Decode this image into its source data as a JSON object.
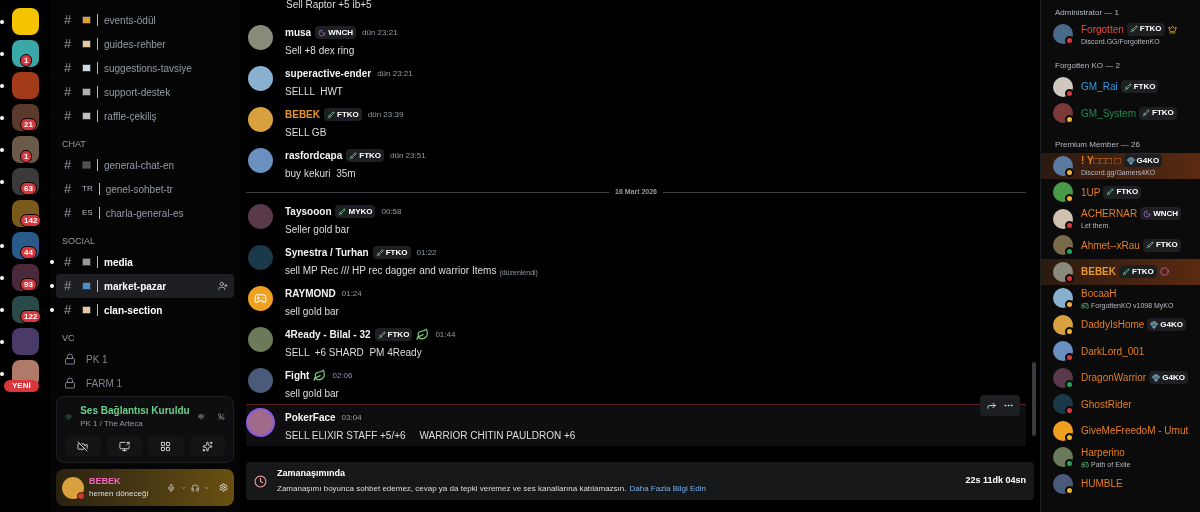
{
  "servers": [
    {
      "unread": true
    },
    {
      "unread": true,
      "badge": "1"
    },
    {
      "unread": true
    },
    {
      "unread": true,
      "badge": "21"
    },
    {
      "unread": true,
      "badge": "1"
    },
    {
      "unread": true,
      "badge": "63"
    },
    {
      "unread": false,
      "badge": "142"
    },
    {
      "unread": true,
      "badge": "44"
    },
    {
      "unread": true,
      "badge": "93"
    },
    {
      "unread": true,
      "badge": "122"
    },
    {
      "unread": true
    },
    {
      "unread": true,
      "new_label": "YENİ"
    }
  ],
  "channels": [
    {
      "kind": "text",
      "hash": "#",
      "name": "events-ödül",
      "unread": false,
      "selected": false
    },
    {
      "kind": "text",
      "hash": "#",
      "name": "guides-rehber",
      "unread": false,
      "selected": false
    },
    {
      "kind": "text",
      "hash": "#",
      "name": "suggestions-tavsiye",
      "unread": false,
      "selected": false
    },
    {
      "kind": "text",
      "hash": "#",
      "name": "support-destek",
      "unread": false,
      "selected": false
    },
    {
      "kind": "text",
      "hash": "#",
      "name": "raffle-çekiliş",
      "unread": false,
      "selected": false
    },
    {
      "kind": "category",
      "name": "CHAT"
    },
    {
      "kind": "text",
      "hash": "#",
      "name": "general-chat-en",
      "unread": false,
      "selected": false
    },
    {
      "kind": "text",
      "hash": "#",
      "prefix": "TR",
      "name": "genel-sohbet-tr",
      "unread": false,
      "selected": false
    },
    {
      "kind": "text",
      "hash": "#",
      "prefix": "ES",
      "name": "charla-general-es",
      "unread": false,
      "selected": false
    },
    {
      "kind": "category",
      "name": "SOCIAL"
    },
    {
      "kind": "text",
      "hash": "#",
      "name": "media",
      "unread": true,
      "selected": false
    },
    {
      "kind": "text",
      "hash": "#",
      "name": "market-pazar",
      "unread": true,
      "selected": true
    },
    {
      "kind": "text",
      "hash": "#",
      "name": "clan-section",
      "unread": true,
      "selected": false
    },
    {
      "kind": "category",
      "name": "VC"
    },
    {
      "kind": "voice",
      "name": "PK 1"
    },
    {
      "kind": "voice",
      "name": "FARM 1"
    }
  ],
  "voice_panel": {
    "status": "Ses Bağlantısı Kuruldu",
    "channel": "PK 1 / The Arteca"
  },
  "user_panel": {
    "name": "BEBEK",
    "status_text": "hemen döneceği"
  },
  "messages": [
    {
      "continued": true,
      "text": "Sell Raptor +5 ib+5"
    },
    {
      "author": "musa",
      "color": "#f2f3f5",
      "tags": [
        {
          "kind": "moon",
          "label": "WNCH"
        }
      ],
      "time": "dün 23:21",
      "text": "Sell +8 dex ring"
    },
    {
      "author": "superactive-ender",
      "color": "#f2f3f5",
      "time": "dün 23:21",
      "text": "SELLL  HWT"
    },
    {
      "author": "BEBEK",
      "color": "#e8962a",
      "tags": [
        {
          "kind": "sword",
          "label": "FTKO"
        }
      ],
      "time": "dün 23:39",
      "text": "SELL GB"
    },
    {
      "author": "rasfordcapa",
      "color": "#f2f3f5",
      "tags": [
        {
          "kind": "sword",
          "label": "FTKO"
        }
      ],
      "time": "dün 23:51",
      "text": "buy kekuri  35m"
    },
    {
      "divider": "16 Mart 2026"
    },
    {
      "author": "Taysooon",
      "color": "#f2f3f5",
      "tags": [
        {
          "kind": "sword",
          "label": "MYKO"
        }
      ],
      "time": "00:58",
      "text": "Seller gold bar"
    },
    {
      "author": "Synestra / Turhan",
      "color": "#f2f3f5",
      "tags": [
        {
          "kind": "sword",
          "label": "FTKO"
        }
      ],
      "time": "01:22",
      "text": "sell MP Rec /// HP rec dagger and warrior Items",
      "edited": "(düzenlendi)"
    },
    {
      "author": "RAYMOND",
      "color": "#f2f3f5",
      "time": "01:24",
      "text": "sell gold bar",
      "default_avatar": true
    },
    {
      "author": "4Ready - Bilal - 32",
      "color": "#f2f3f5",
      "tags": [
        {
          "kind": "sword",
          "label": "FTKO"
        },
        {
          "kind": "leaf"
        }
      ],
      "time": "01:44",
      "text": "SELL  +6 SHARD  PM 4Ready"
    },
    {
      "author": "Fight",
      "color": "#f2f3f5",
      "tags": [
        {
          "kind": "leaf"
        }
      ],
      "time": "02:06",
      "text": "sell gold bar"
    },
    {
      "new_marker": true
    },
    {
      "author": "PokerFace",
      "color": "#f2f3f5",
      "time": "03:04",
      "text": "SELL ELIXIR STAFF +5/+6     WARRIOR CHITIN PAULDRON +6",
      "hovered": true
    }
  ],
  "timeout": {
    "title": "Zamanaşımında",
    "text": "Zamanaşımı boyunca sohbet edemez, cevap ya da tepki veremez ve ses kanallarına katılamazsın.",
    "link": "Daha Fazla Bilgi Edin",
    "remaining": "22s 11dk 04sn"
  },
  "member_groups": [
    {
      "title": "Administrator — 1",
      "members": [
        {
          "name": "Forgotten",
          "color": "#e74c3c",
          "tags": [
            {
              "kind": "sword",
              "label": "FTKO"
            }
          ],
          "crown": true,
          "kind": "dnd",
          "sub": "Discord.GG/ForgottenKO"
        }
      ]
    },
    {
      "title": "Forgotten KO — 2",
      "members": [
        {
          "name": "GM_Rai",
          "color": "#3498db",
          "tags": [
            {
              "kind": "sword",
              "label": "FTKO"
            }
          ],
          "kind": "dnd"
        },
        {
          "name": "GM_System",
          "color": "#1f8b4c",
          "tags": [
            {
              "kind": "sword",
              "label": "FTKO"
            }
          ],
          "kind": "idle"
        }
      ]
    },
    {
      "title": "Premium Member — 26",
      "members": [
        {
          "name": "! Y□□□ □",
          "color": "#e67e22",
          "tags": [
            {
              "kind": "gem",
              "label": "G4KO"
            }
          ],
          "kind": "idle",
          "sub": "Discord.gg/Gamers4KO",
          "banner": true
        },
        {
          "name": "1UP",
          "color": "#e67e22",
          "tags": [
            {
              "kind": "sword",
              "label": "FTKO"
            }
          ],
          "kind": "idle"
        },
        {
          "name": "ACHERNAR",
          "color": "#e67e22",
          "tags": [
            {
              "kind": "moon",
              "label": "WNCH"
            }
          ],
          "kind": "dnd",
          "sub": "Let them."
        },
        {
          "name": "Ahmet--xRau",
          "color": "#e67e22",
          "tags": [
            {
              "kind": "sword",
              "label": "FTKO"
            }
          ],
          "kind": "online"
        },
        {
          "name": "BEBEK",
          "color": "#e8962a",
          "tags": [
            {
              "kind": "sword",
              "label": "FTKO"
            },
            {
              "kind": "pink"
            }
          ],
          "kind": "dnd",
          "banner": true,
          "bold": true
        },
        {
          "name": "BocaaH",
          "color": "#e67e22",
          "kind": "idle",
          "sub": "ForgottenKO v1098 MyKO",
          "game": true
        },
        {
          "name": "DaddyIsHome",
          "color": "#e67e22",
          "tags": [
            {
              "kind": "gem",
              "label": "G4KO"
            }
          ],
          "kind": "idle"
        },
        {
          "name": "DarkLord_001",
          "color": "#e67e22",
          "kind": "dnd"
        },
        {
          "name": "DragonWarrior",
          "color": "#e67e22",
          "tags": [
            {
              "kind": "gem",
              "label": "G4KO"
            }
          ],
          "kind": "online"
        },
        {
          "name": "GhostRider",
          "color": "#e67e22",
          "kind": "dnd"
        },
        {
          "name": "GiveMeFreedoM - Umut",
          "color": "#e67e22",
          "kind": "idle"
        },
        {
          "name": "Harperino",
          "color": "#e67e22",
          "kind": "online",
          "sub": "Path of Exile",
          "game": true
        },
        {
          "name": "HUMBLE",
          "color": "#e67e22",
          "kind": "idle"
        }
      ]
    }
  ]
}
